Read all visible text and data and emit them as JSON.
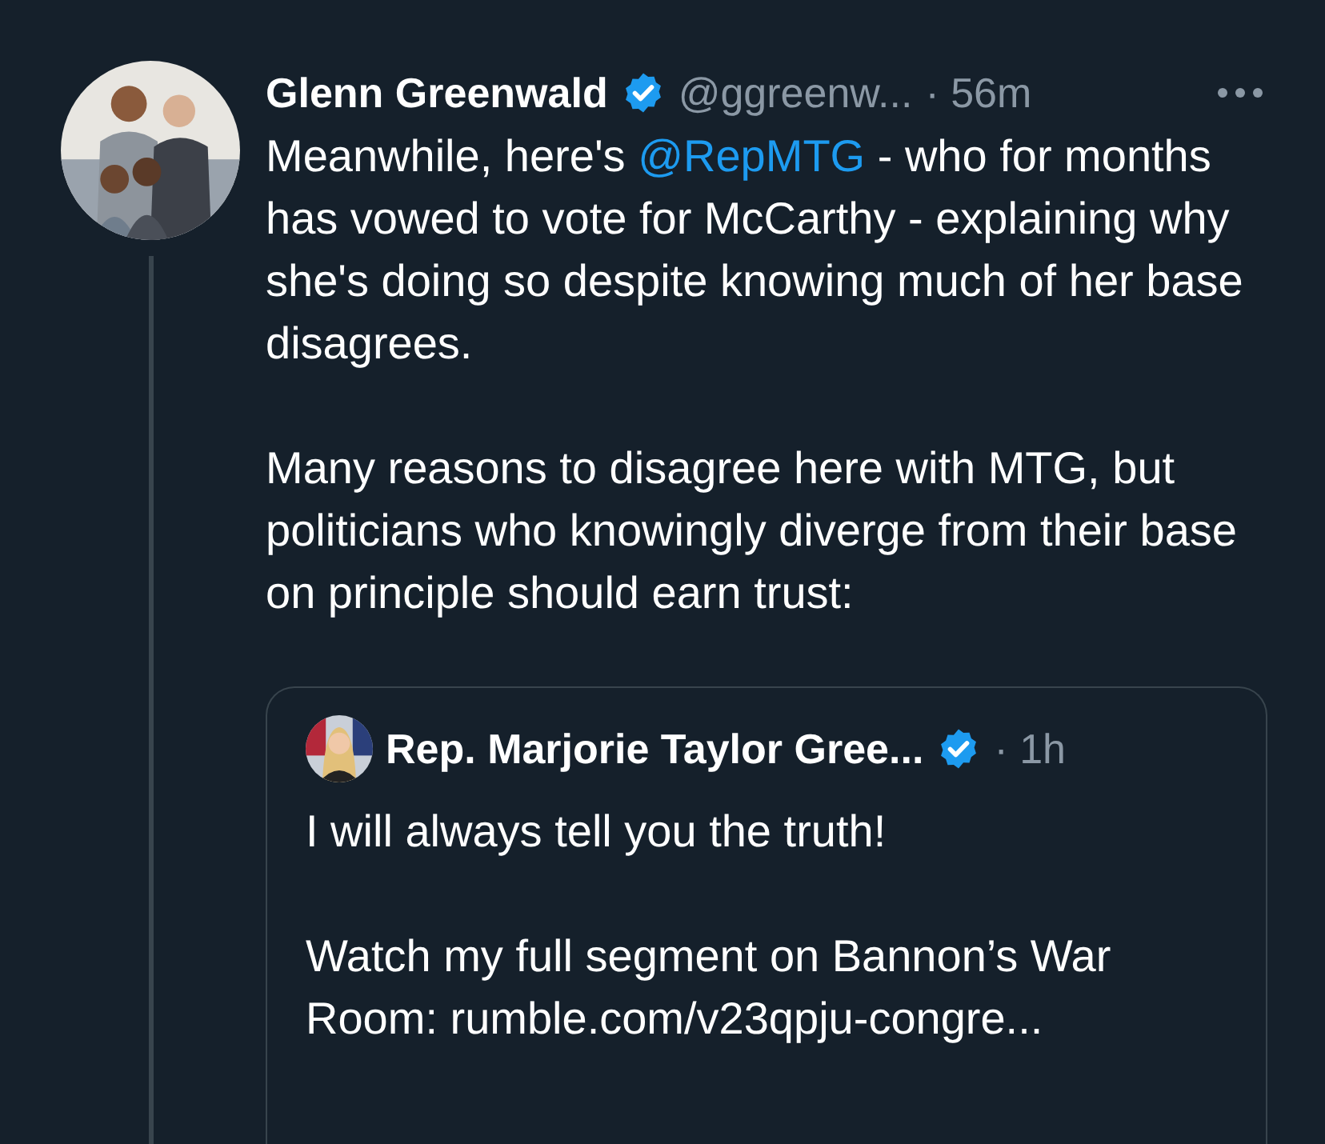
{
  "tweet": {
    "author": {
      "name": "Glenn Greenwald",
      "verified": true,
      "handle": "@ggreenw...",
      "time": "· 56m"
    },
    "paragraphs": [
      [
        {
          "kind": "text",
          "text": "Meanwhile, here's "
        },
        {
          "kind": "mention",
          "text": "@RepMTG"
        },
        {
          "kind": "text",
          "text": " - who for months has vowed to vote for McCarthy - explaining why she's doing so despite knowing much of her base disagrees."
        }
      ],
      [
        {
          "kind": "text",
          "text": "Many reasons to disagree here with MTG, but politicians who knowingly diverge from their base on principle should earn trust:"
        }
      ]
    ],
    "quote": {
      "author": {
        "name": "Rep. Marjorie Taylor Gree...",
        "verified": true,
        "time": "· 1h"
      },
      "paragraphs": [
        "I will always tell you the truth!",
        "Watch my full segment on Bannon’s War Room: rumble.com/v23qpju-congre..."
      ]
    }
  }
}
